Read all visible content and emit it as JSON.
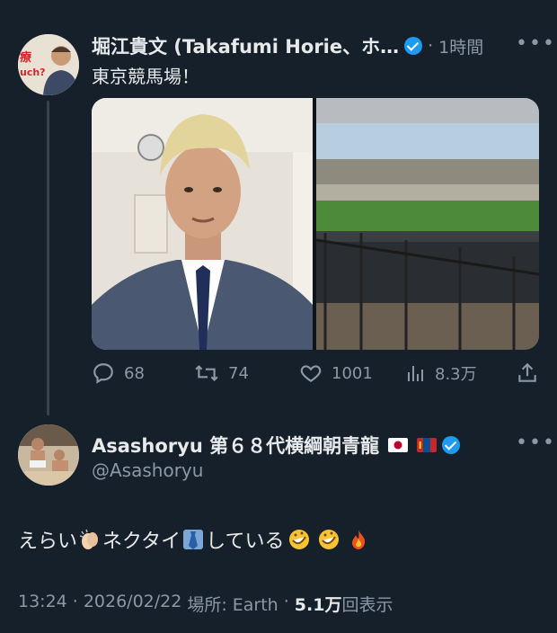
{
  "tweet": {
    "author_name": "堀江貴文 (Takafumi Horie、ホ…",
    "dot": "·",
    "time_ago": "1時間",
    "text": "東京競馬場！",
    "stats": {
      "replies": "68",
      "retweets": "74",
      "likes": "1001",
      "views": "8.3万"
    }
  },
  "reply": {
    "author_name": "Asashoryu 第６８代横綱朝青龍",
    "handle": "@Asashoryu",
    "text_parts": [
      "えらい",
      "ネクタイ",
      "している"
    ],
    "meta": {
      "time": "13:24",
      "sep": "·",
      "date": "2026/02/22",
      "location": "場所: Earth",
      "views_count": "5.1万",
      "views_label": "回表示"
    }
  },
  "colors": {
    "background": "#15202b",
    "text": "#e7e9ea",
    "muted": "#8b98a5",
    "verified": "#1d9bf0"
  },
  "icons": [
    "verified-badge-icon",
    "more-icon",
    "reply-icon",
    "retweet-icon",
    "like-icon",
    "views-icon",
    "share-icon",
    "japan-flag-icon",
    "mongolia-flag-icon",
    "clapping-hands-emoji",
    "necktie-emoji",
    "rofl-emoji",
    "fire-emoji"
  ]
}
